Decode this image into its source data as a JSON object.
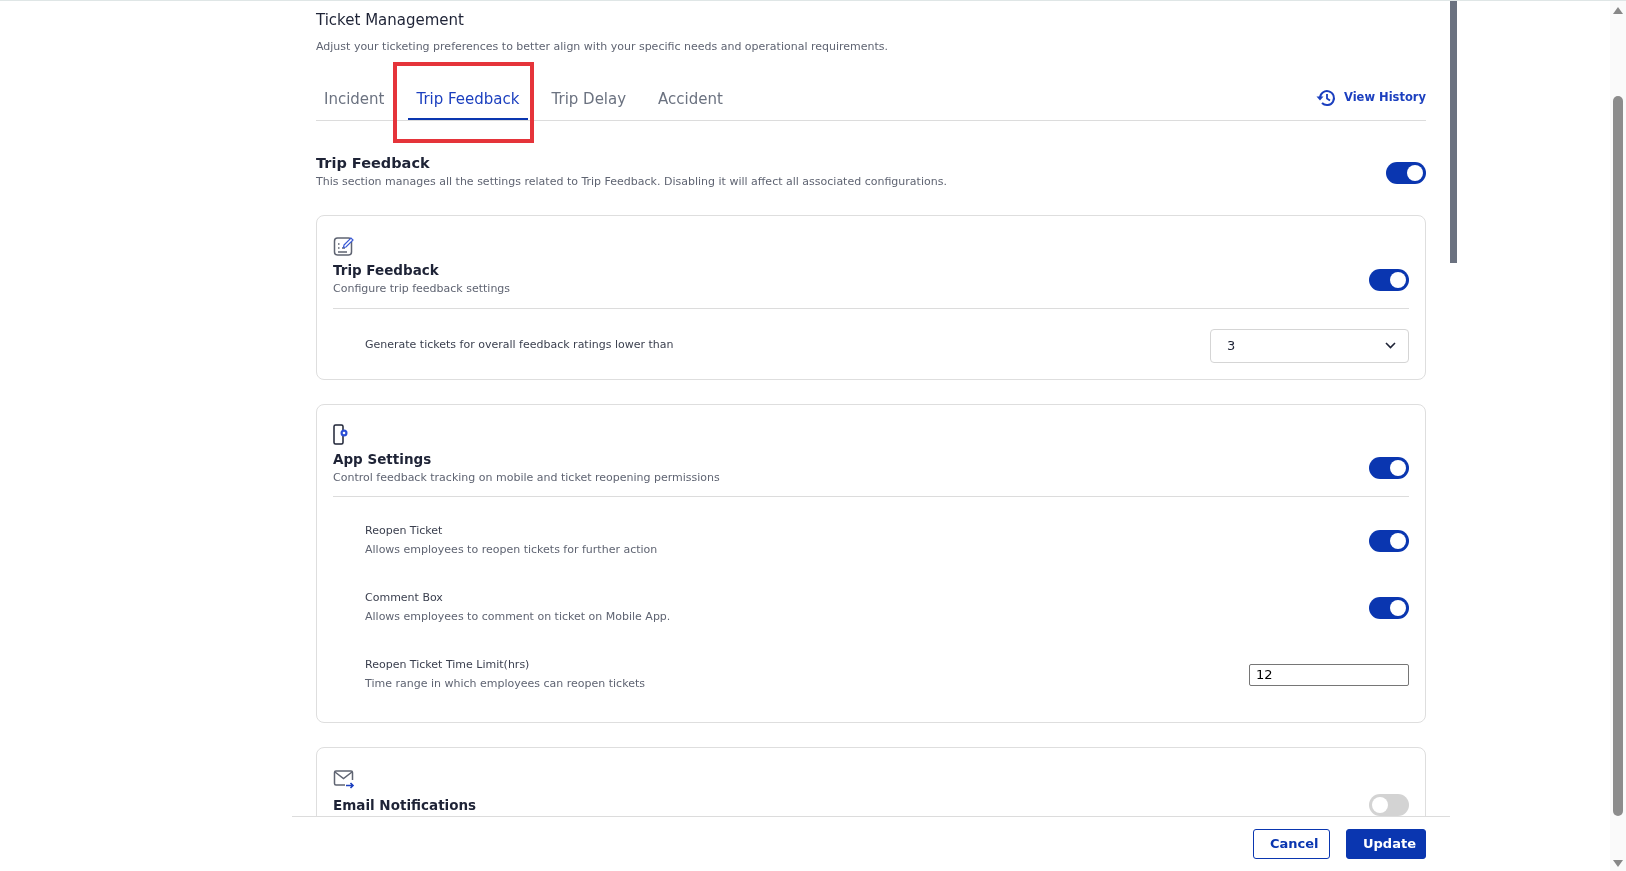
{
  "page": {
    "title": "Ticket Management",
    "subtitle": "Adjust your ticketing preferences to better align with your specific needs and operational requirements."
  },
  "tabs": [
    {
      "label": "Incident",
      "selected": false,
      "highlighted": false
    },
    {
      "label": "Trip Feedback",
      "selected": true,
      "highlighted": true
    },
    {
      "label": "Trip Delay",
      "selected": false,
      "highlighted": false
    },
    {
      "label": "Accident",
      "selected": false,
      "highlighted": false
    }
  ],
  "view_history": "View History",
  "section": {
    "title": "Trip Feedback",
    "description": "This section manages all the settings related to Trip Feedback. Disabling it will affect all associated configurations.",
    "on": true
  },
  "cards": [
    {
      "kind": "feedback",
      "title": "Trip Feedback",
      "description": "Configure trip feedback settings",
      "on": true,
      "settings": [
        {
          "kind": "select",
          "label": "Generate tickets for overall feedback ratings lower than",
          "value": "3"
        }
      ]
    },
    {
      "kind": "phone",
      "title": "App Settings",
      "description": "Control feedback tracking on mobile and ticket reopening permissions",
      "on": true,
      "settings": [
        {
          "kind": "toggle",
          "label": "Reopen Ticket",
          "description": "Allows employees to reopen tickets for further action",
          "on": true
        },
        {
          "kind": "toggle",
          "label": "Comment Box",
          "description": "Allows employees to comment on ticket on Mobile App.",
          "on": true
        },
        {
          "kind": "input",
          "label": "Reopen Ticket Time Limit(hrs)",
          "description": "Time range in which employees can reopen tickets",
          "value": "12"
        }
      ]
    },
    {
      "kind": "mail",
      "title": "Email Notifications",
      "on": false
    }
  ],
  "footer": {
    "buttons": [
      {
        "label": "Cancel",
        "kind": "secondary"
      },
      {
        "label": "Update",
        "kind": "primary"
      }
    ]
  }
}
